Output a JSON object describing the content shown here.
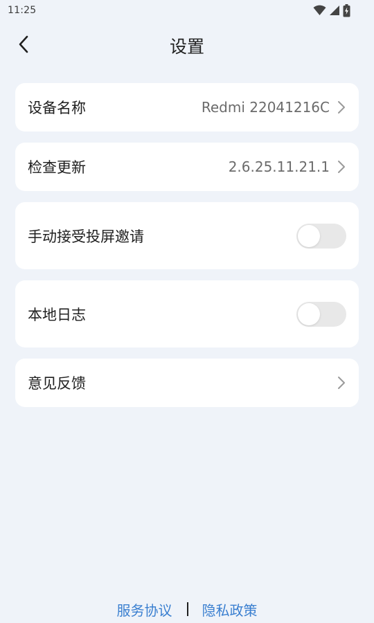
{
  "status_bar": {
    "time": "11:25",
    "icons": [
      "wifi-icon",
      "cellular-signal-icon",
      "battery-charging-icon"
    ]
  },
  "header": {
    "title": "设置",
    "back_icon": "chevron-left-icon"
  },
  "settings": {
    "device_name": {
      "label": "设备名称",
      "value": "Redmi 22041216C"
    },
    "check_update": {
      "label": "检查更新",
      "value": "2.6.25.11.21.1"
    },
    "manual_accept": {
      "label": "手动接受投屏邀请",
      "enabled": false
    },
    "local_log": {
      "label": "本地日志",
      "enabled": false
    },
    "feedback": {
      "label": "意见反馈"
    }
  },
  "footer": {
    "service_agreement": "服务协议",
    "privacy_policy": "隐私政策"
  },
  "colors": {
    "background": "#eff3f9",
    "card": "#ffffff",
    "link": "#3a7fd0",
    "toggle_off": "#e8e8e8"
  }
}
